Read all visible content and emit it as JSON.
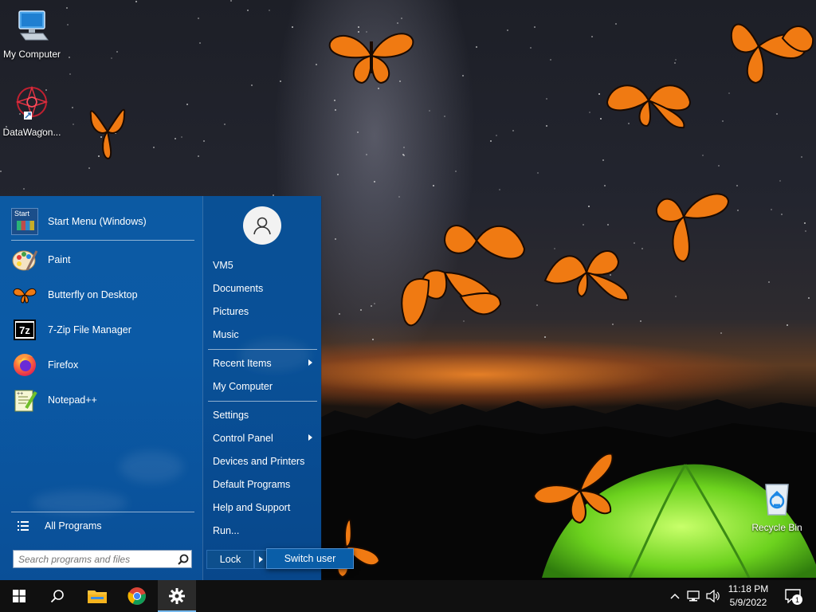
{
  "desktop": {
    "icons": [
      {
        "label": "My Computer",
        "icon": "computer-icon"
      },
      {
        "label": "DataWagon...",
        "icon": "datawagon-shortcut-icon"
      },
      {
        "label": "Recycle Bin",
        "icon": "recycle-bin-icon"
      }
    ]
  },
  "start_menu": {
    "pinned": [
      {
        "label": "Start Menu (Windows)",
        "icon": "start-menu-app-icon"
      },
      {
        "label": "Paint",
        "icon": "paint-icon"
      },
      {
        "label": "Butterfly on Desktop",
        "icon": "butterfly-icon"
      },
      {
        "label": "7-Zip File Manager",
        "icon": "7zip-icon"
      },
      {
        "label": "Firefox",
        "icon": "firefox-icon"
      },
      {
        "label": "Notepad++",
        "icon": "notepadpp-icon"
      }
    ],
    "all_programs": "All Programs",
    "search_placeholder": "Search programs and files",
    "right": {
      "user": "VM5",
      "items_group1": [
        "Documents",
        "Pictures",
        "Music"
      ],
      "items_group2": [
        {
          "label": "Recent Items",
          "submenu": true
        },
        {
          "label": "My Computer",
          "submenu": false
        }
      ],
      "items_group3": [
        {
          "label": "Settings",
          "submenu": false
        },
        {
          "label": "Control Panel",
          "submenu": true
        },
        {
          "label": "Devices and Printers",
          "submenu": false
        },
        {
          "label": "Default Programs",
          "submenu": false
        },
        {
          "label": "Help and Support",
          "submenu": false
        },
        {
          "label": "Run...",
          "submenu": false
        }
      ],
      "lock_label": "Lock",
      "switch_user_label": "Switch user"
    },
    "start_tile_text": "Start"
  },
  "taskbar": {
    "buttons": [
      "windows-start-icon",
      "search-icon",
      "file-explorer-icon",
      "chrome-icon",
      "settings-gear-icon"
    ],
    "time": "11:18 PM",
    "date": "5/9/2022",
    "notification_count": "1"
  },
  "colors": {
    "start_menu_blue": "#0b5aa6",
    "taskbar": "#101010",
    "accent": "#76b9ed"
  }
}
